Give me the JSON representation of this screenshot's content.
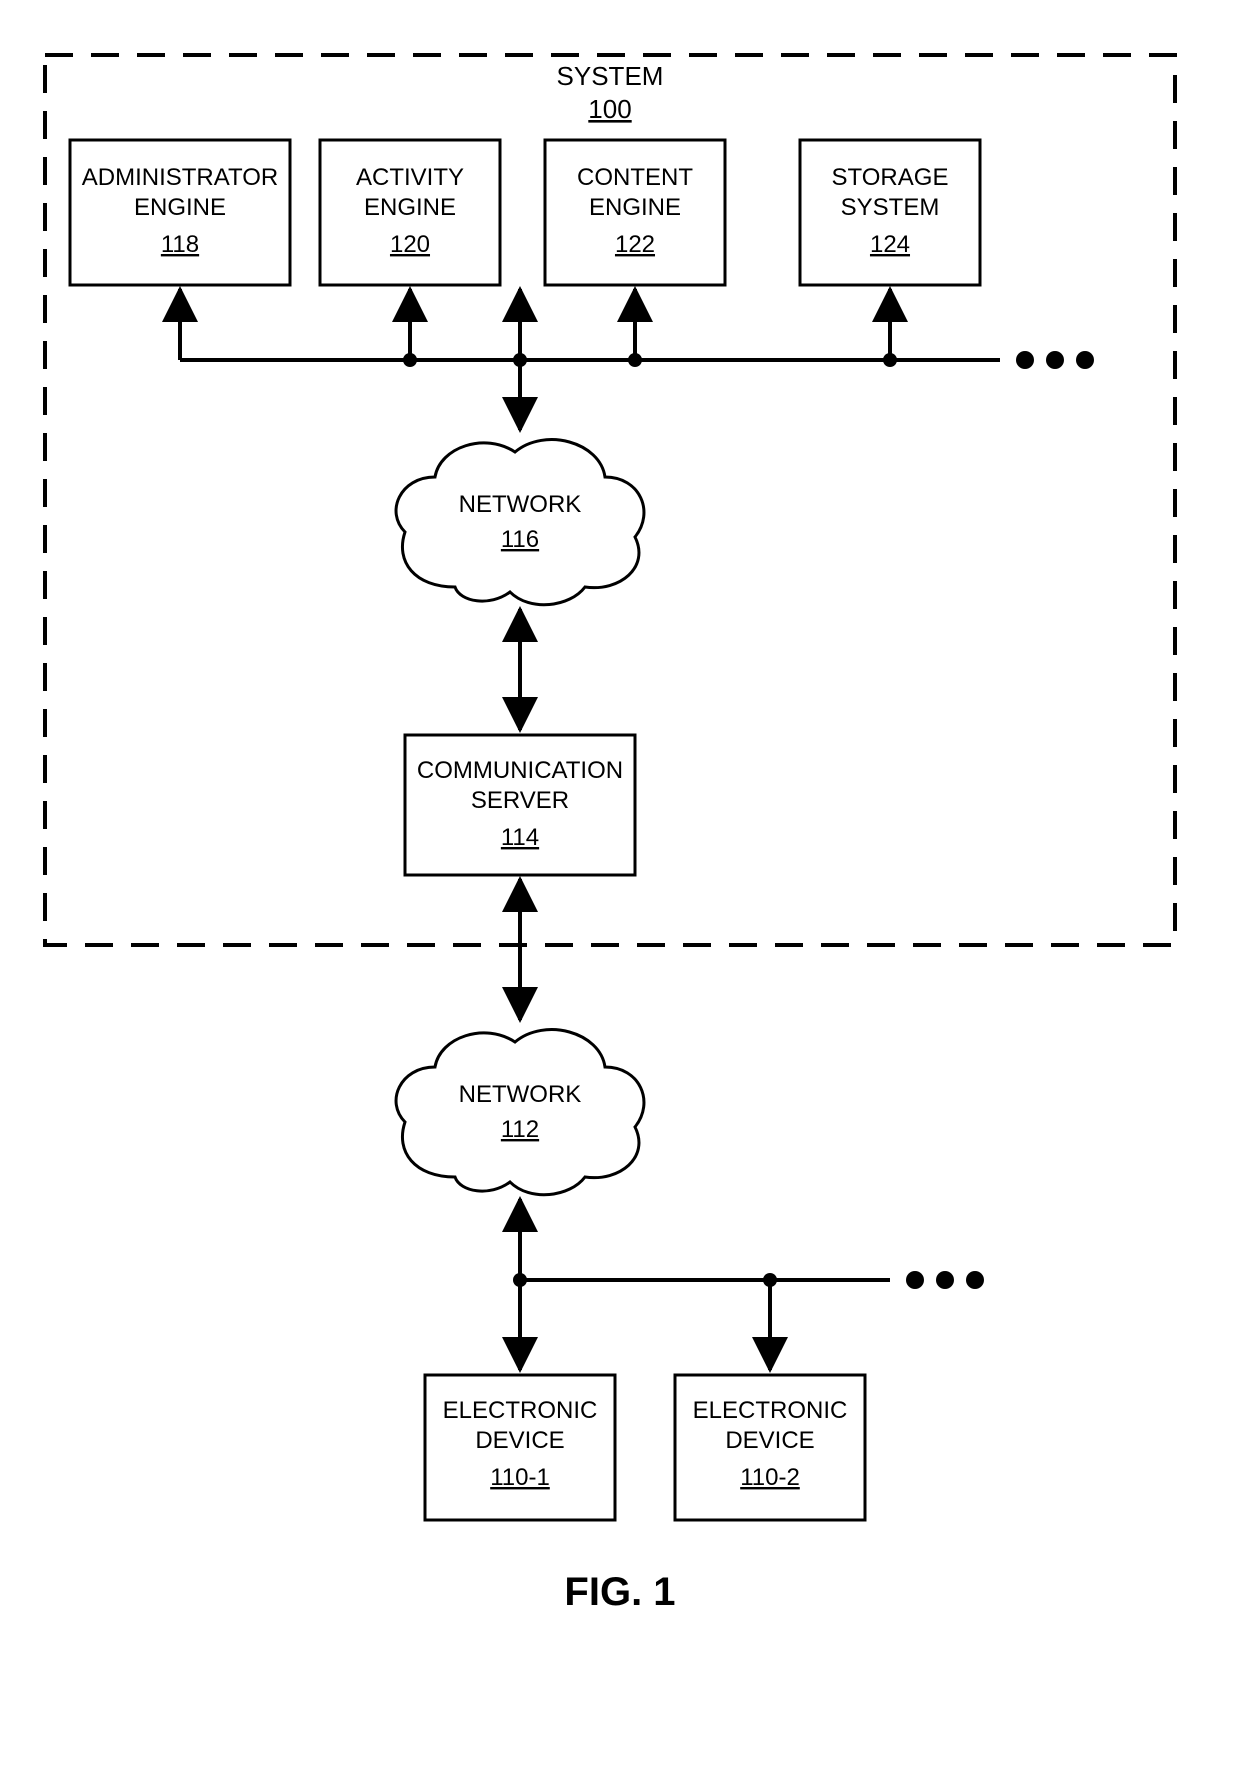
{
  "figure_label": "FIG. 1",
  "system": {
    "title": "SYSTEM",
    "ref": "100"
  },
  "boxes": {
    "admin": {
      "title1": "ADMINISTRATOR",
      "title2": "ENGINE",
      "ref": "118"
    },
    "activity": {
      "title1": "ACTIVITY",
      "title2": "ENGINE",
      "ref": "120"
    },
    "content": {
      "title1": "CONTENT",
      "title2": "ENGINE",
      "ref": "122"
    },
    "storage": {
      "title1": "STORAGE",
      "title2": "SYSTEM",
      "ref": "124"
    },
    "comm": {
      "title1": "COMMUNICATION",
      "title2": "SERVER",
      "ref": "114"
    },
    "dev1": {
      "title1": "ELECTRONIC",
      "title2": "DEVICE",
      "ref": "110-1"
    },
    "dev2": {
      "title1": "ELECTRONIC",
      "title2": "DEVICE",
      "ref": "110-2"
    }
  },
  "clouds": {
    "net_top": {
      "title": "NETWORK",
      "ref": "116"
    },
    "net_bottom": {
      "title": "NETWORK",
      "ref": "112"
    }
  }
}
